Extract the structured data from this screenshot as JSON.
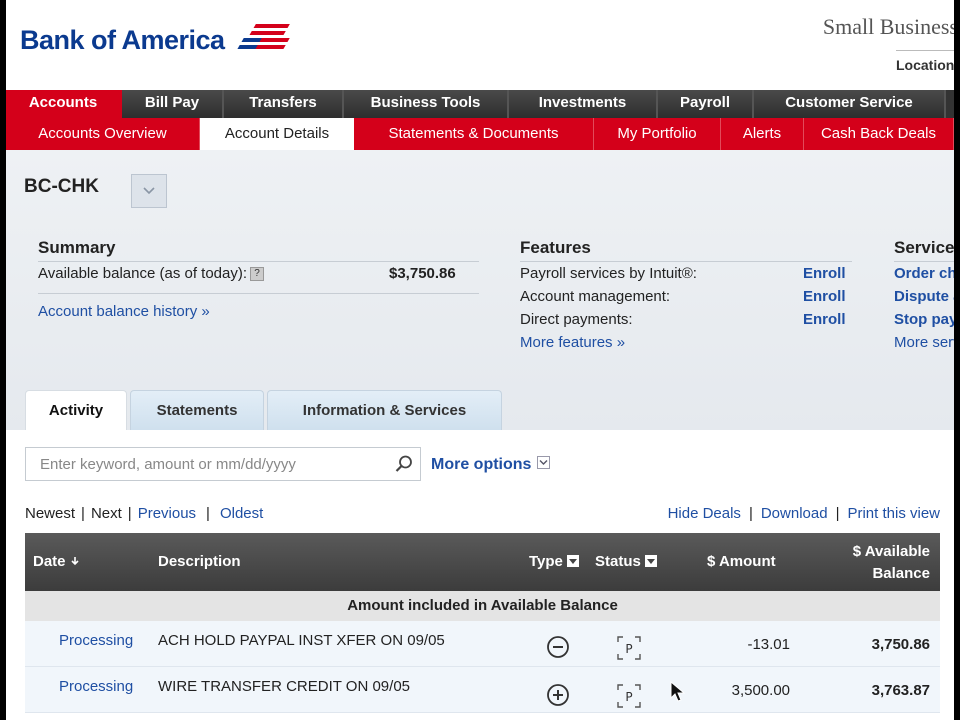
{
  "header": {
    "logo_text": "Bank of America",
    "segment_label": "Small Business",
    "location_label": "Location"
  },
  "main_nav": [
    {
      "label": "Accounts",
      "active": true
    },
    {
      "label": "Bill Pay"
    },
    {
      "label": "Transfers"
    },
    {
      "label": "Business Tools"
    },
    {
      "label": "Investments"
    },
    {
      "label": "Payroll"
    },
    {
      "label": "Customer Service"
    }
  ],
  "sub_nav": [
    {
      "label": "Accounts Overview"
    },
    {
      "label": "Account Details",
      "active": true
    },
    {
      "label": "Statements & Documents"
    },
    {
      "label": "My Portfolio"
    },
    {
      "label": "Alerts"
    },
    {
      "label": "Cash Back Deals"
    }
  ],
  "account": {
    "name": "BC-CHK"
  },
  "summary": {
    "title": "Summary",
    "available_label": "Available balance (as of today):",
    "help": "?",
    "available_value": "$3,750.86",
    "history_link": "Account balance history »"
  },
  "features": {
    "title": "Features",
    "items": [
      {
        "label": "Payroll services by Intuit®:",
        "action": "Enroll"
      },
      {
        "label": "Account management:",
        "action": "Enroll"
      },
      {
        "label": "Direct payments:",
        "action": "Enroll"
      }
    ],
    "more_link": "More features »"
  },
  "services": {
    "title": "Services",
    "items": [
      "Order checks",
      "Dispute a transaction",
      "Stop payments"
    ],
    "more_link": "More services »"
  },
  "content_tabs": [
    {
      "label": "Activity",
      "active": true
    },
    {
      "label": "Statements"
    },
    {
      "label": "Information & Services"
    }
  ],
  "search": {
    "placeholder": "Enter keyword, amount or mm/dd/yyyy",
    "more_options": "More options"
  },
  "pager": {
    "newest": "Newest",
    "next": "Next",
    "previous": "Previous",
    "oldest": "Oldest"
  },
  "right_links": {
    "hide_deals": "Hide Deals",
    "download": "Download",
    "print": "Print this view"
  },
  "table": {
    "columns": {
      "date": "Date",
      "description": "Description",
      "type": "Type",
      "status": "Status",
      "amount": "$ Amount",
      "balance_line1": "$ Available",
      "balance_line2": "Balance"
    },
    "group_label": "Amount included in Available Balance",
    "rows": [
      {
        "date": "Processing",
        "description": "ACH HOLD PAYPAL INST XFER ON 09/05",
        "type": "debit",
        "status": "P",
        "amount": "-13.01",
        "balance": "3,750.86"
      },
      {
        "date": "Processing",
        "description": "WIRE TRANSFER CREDIT ON 09/05",
        "type": "credit",
        "status": "P",
        "amount": "3,500.00",
        "balance": "3,763.87"
      }
    ]
  },
  "colors": {
    "brand_red": "#d4001a",
    "brand_blue": "#0b3a8f",
    "link": "#1f4fa3"
  }
}
